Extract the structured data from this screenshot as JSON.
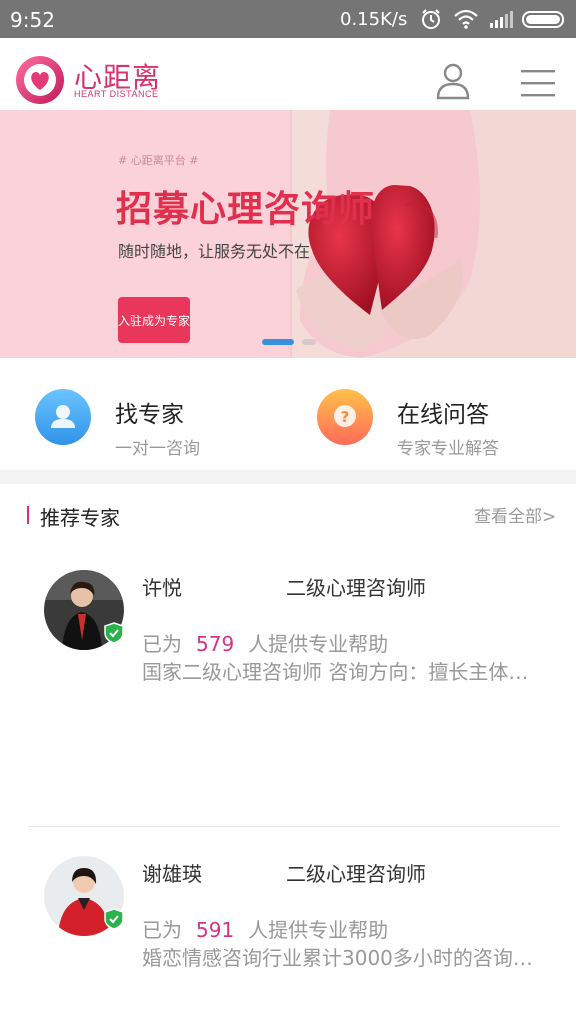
{
  "status_bar": {
    "time": "9:52",
    "speed": "0.15K/s",
    "icons": [
      "alarm-icon",
      "wifi-icon",
      "signal-icon",
      "battery-icon"
    ]
  },
  "header": {
    "logo_cn": "心距离",
    "logo_en": "HEART DISTANCE",
    "user_icon": "user-icon",
    "menu_icon": "menu-icon",
    "brand_color": "#d6336c"
  },
  "banner": {
    "tag": "# 心距离平台 #",
    "title": "招募心理咨询师",
    "subtitle": "随时随地，让服务无处不在",
    "button_label": "入驻成为专家",
    "active_slide": 1,
    "slide_count": 2
  },
  "quick_entries": [
    {
      "title": "找专家",
      "subtitle": "一对一咨询",
      "icon": "expert-icon",
      "color": "#3aa6f0"
    },
    {
      "title": "在线问答",
      "subtitle": "专家专业解答",
      "icon": "question-icon",
      "color": "#ff9b3a"
    }
  ],
  "section": {
    "title": "推荐专家",
    "see_all": "查看全部>"
  },
  "experts": [
    {
      "name": "许悦",
      "title": "二级心理咨询师",
      "help_prefix": "已为",
      "count": "579",
      "help_suffix": "人提供专业帮助",
      "description": "国家二级心理咨询师 咨询方向：擅长主体…"
    },
    {
      "name": "谢雄瑛",
      "title": "二级心理咨询师",
      "help_prefix": "已为",
      "count": "591",
      "help_suffix": "人提供专业帮助",
      "description": "婚恋情感咨询行业累计3000多小时的咨询…"
    }
  ],
  "colors": {
    "accent_pink": "#e0306a",
    "count_color": "#d63384",
    "status_bar": "#757575"
  }
}
